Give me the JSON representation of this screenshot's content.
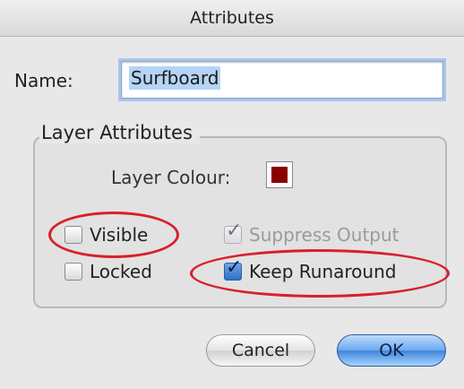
{
  "window": {
    "title": "Attributes"
  },
  "name_field": {
    "label": "Name:",
    "value": "Surfboard"
  },
  "layer_attributes": {
    "title": "Layer Attributes",
    "colour_label": "Layer Colour:",
    "colour_value": "#8b0000",
    "checkboxes": {
      "visible": {
        "label": "Visible",
        "checked": false
      },
      "locked": {
        "label": "Locked",
        "checked": false
      },
      "suppress_output": {
        "label": "Suppress Output",
        "checked": true,
        "enabled": false
      },
      "keep_runaround": {
        "label": "Keep Runaround",
        "checked": true
      }
    }
  },
  "buttons": {
    "cancel": "Cancel",
    "ok": "OK"
  },
  "annotation_color": "#d8202a"
}
